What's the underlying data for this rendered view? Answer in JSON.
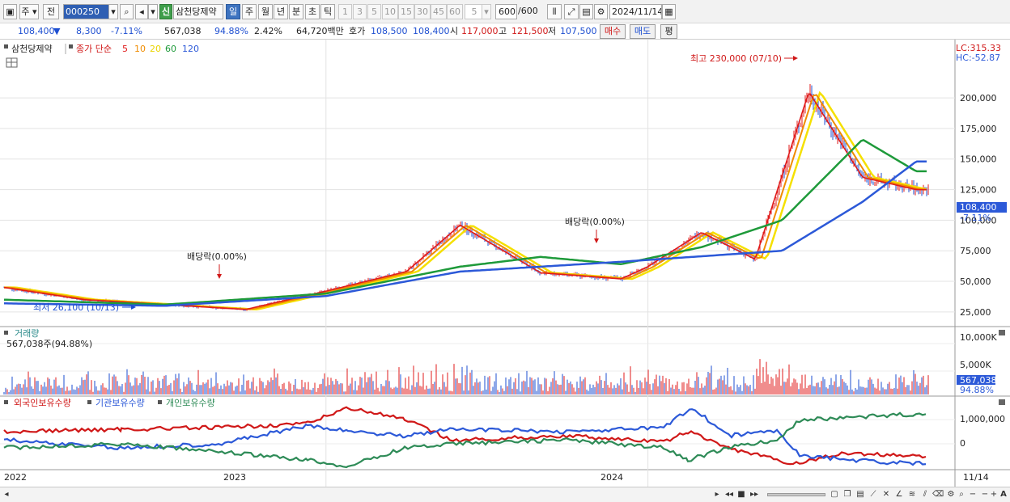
{
  "toolbar": {
    "market_label": "주",
    "prev_label": "전",
    "code_value": "000250",
    "badge_label": "신",
    "stock_name": "삼천당제약",
    "period_tabs": [
      "일",
      "주",
      "월",
      "년",
      "분",
      "초",
      "틱"
    ],
    "active_period": "일",
    "interval_buttons": [
      "1",
      "3",
      "5",
      "10",
      "15",
      "30",
      "45",
      "60"
    ],
    "interval_value": "5",
    "count_value": "600",
    "count_total": "/600",
    "date_value": "2024/11/14"
  },
  "quote": {
    "price": "108,400",
    "change_arrow": "▼",
    "change": "8,300",
    "change_pct": "-7.11%",
    "volume": "567,038",
    "volume_ratio": "94.88%",
    "turnover": "2.42%",
    "trade_value": "64,720백만",
    "bid_label": "호가",
    "bid": "108,500",
    "ask": "108,400",
    "open_label": "시",
    "open": "117,000",
    "high_label": "고",
    "high": "121,500",
    "low_label": "저",
    "low": "107,500",
    "buy_button": "매수",
    "sell_button": "매도",
    "eval_button": "평"
  },
  "price_panel": {
    "legend_stock": "삼천당제약",
    "legend_ma_prefix": "종가 단순",
    "legend_ma": [
      {
        "label": "5",
        "color": "#e01b1b"
      },
      {
        "label": "10",
        "color": "#f08c00"
      },
      {
        "label": "20",
        "color": "#f5e000"
      },
      {
        "label": "60",
        "color": "#1e9a3a"
      },
      {
        "label": "120",
        "color": "#2c59d8"
      }
    ],
    "y_ticks": [
      "200,000",
      "175,000",
      "150,000",
      "125,000",
      "100,000",
      "75,000",
      "50,000",
      "25,000"
    ],
    "lc_label": "LC:315.33",
    "hc_label": "HC:-52.87",
    "current_price_tag": "108,400",
    "current_pct_tag": "-7.11%",
    "annotations": {
      "high": "최고 230,000 (07/10)",
      "low": "최저 26,100 (10/13)",
      "dividend1": "배당락(0.00%)",
      "dividend2": "배당락(0.00%)"
    }
  },
  "volume_panel": {
    "title": "거래량",
    "value_text": "567,038주(94.88%)",
    "y_ticks": [
      "10,000K",
      "5,000K"
    ],
    "current_tag": "567,038",
    "current_pct": "94.88%"
  },
  "holding_panel": {
    "legend": [
      {
        "label": "외국인보유수량",
        "color": "#d01818"
      },
      {
        "label": "기관보유수량",
        "color": "#2c59d8"
      },
      {
        "label": "개인보유수량",
        "color": "#2e8b57"
      }
    ],
    "y_ticks": [
      "1,000,000",
      "0"
    ]
  },
  "x_axis": {
    "labels": [
      "2022",
      "2023",
      "2024"
    ],
    "end_label": "11/14"
  },
  "colors": {
    "candle_up": "#e01b1b",
    "candle_down": "#1e4fd1",
    "grid": "#dcdcdc",
    "accent": "#3d73c0"
  },
  "chart_data": {
    "type": "line",
    "title": "삼천당제약",
    "ylim": [
      15000,
      245000
    ],
    "series": [
      {
        "name": "5",
        "x": [
          "2022-01",
          "2022-04",
          "2022-07",
          "2022-10",
          "2023-01",
          "2023-04",
          "2023-06",
          "2023-09",
          "2023-12",
          "2024-01",
          "2024-03",
          "2024-05",
          "2024-07",
          "2024-09",
          "2024-11"
        ],
        "values": [
          45000,
          35000,
          31000,
          27000,
          42000,
          58000,
          96000,
          57000,
          52000,
          62000,
          90000,
          68000,
          205000,
          135000,
          125000
        ]
      },
      {
        "name": "60",
        "x": [
          "2022-01",
          "2022-07",
          "2023-01",
          "2023-06",
          "2023-09",
          "2023-12",
          "2024-03",
          "2024-06",
          "2024-09",
          "2024-11"
        ],
        "values": [
          35000,
          31000,
          40000,
          62000,
          70000,
          64000,
          78000,
          100000,
          166000,
          140000
        ]
      },
      {
        "name": "120",
        "x": [
          "2022-01",
          "2022-07",
          "2023-01",
          "2023-06",
          "2023-12",
          "2024-06",
          "2024-09",
          "2024-11"
        ],
        "values": [
          32000,
          30000,
          38000,
          58000,
          66000,
          75000,
          115000,
          148000
        ]
      }
    ]
  }
}
